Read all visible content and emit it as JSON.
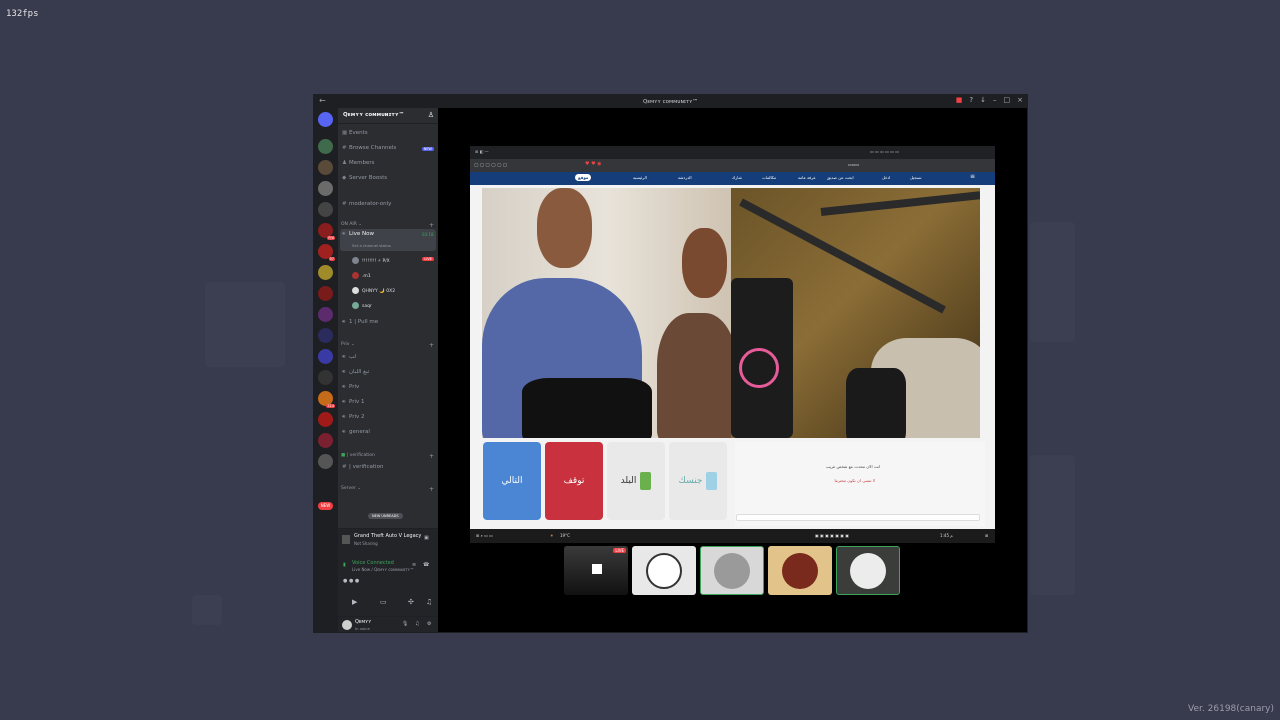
{
  "overlay": {
    "fps": "132fps",
    "version": "Ver. 26198(canary)"
  },
  "window": {
    "title": "Qᴇᴍʏʏ ᴄᴏᴍᴍᴜɴɪᴛʏ™"
  },
  "server": {
    "name": "Qᴇᴍʏʏ ᴄᴏᴍᴍᴜɴɪᴛʏ™",
    "top_items": [
      {
        "label": "Events"
      },
      {
        "label": "Browse Channels",
        "badge": "NEW"
      },
      {
        "label": "Members"
      },
      {
        "label": "Server Boosts"
      }
    ],
    "moderator_channel": "moderator-only",
    "categories": {
      "on_air": "ON AIR",
      "priv": "Priv",
      "verification": "verification",
      "server": "Server"
    },
    "live_now": {
      "name": "Live Now",
      "time": "03:18",
      "status": "Set a channel status"
    },
    "voice_users": [
      {
        "name": "!!!!!!!! ⚡ P/X",
        "live": "LIVE"
      },
      {
        "name": ".m1"
      },
      {
        "name": "QHNYY 🌙 0X2"
      },
      {
        "name": "saqr"
      }
    ],
    "channels": [
      "1 | Pull me",
      "لب",
      "تبغ اللبان",
      "Priv",
      "Priv 1",
      "Priv 2",
      "general"
    ],
    "verification_channel": "| verification",
    "new_unreads": "NEW UNREADS",
    "new_server": "NEW"
  },
  "activity": {
    "game": "Grand Theft Auto V Legacy",
    "status": "Not Sharing"
  },
  "voice_panel": {
    "status": "Voice Connected",
    "channel": "Live Now / Qᴇᴍʏʏ ᴄᴏᴍᴍᴜɴɪᴛʏ™"
  },
  "user_panel": {
    "name": "Qᴇᴍʏʏ",
    "status": "In voice"
  },
  "stream": {
    "site_logo": "موقع",
    "nav_links": [
      "الرئيسية",
      "الدردشة",
      "شارك",
      "مكالمات",
      "غرفة عامة",
      "ابحث عن صديق",
      "ادخل",
      "تسجيل"
    ],
    "buttons": {
      "next": "التالي",
      "stop": "توقف",
      "country": "البلد",
      "gender": "جنسك"
    },
    "chat_line1": "انت الان تتحدث مع شخص غريب",
    "chat_line2": "لا تنسى ان تكون محترما",
    "taskbar_weather": "19°C",
    "taskbar_time": "1:45 م"
  },
  "tiles": [
    {
      "name": "stream-preview",
      "badge": "LIVE"
    },
    {
      "name": "member-2"
    },
    {
      "name": "member-3"
    },
    {
      "name": "member-4"
    },
    {
      "name": "member-5"
    }
  ]
}
